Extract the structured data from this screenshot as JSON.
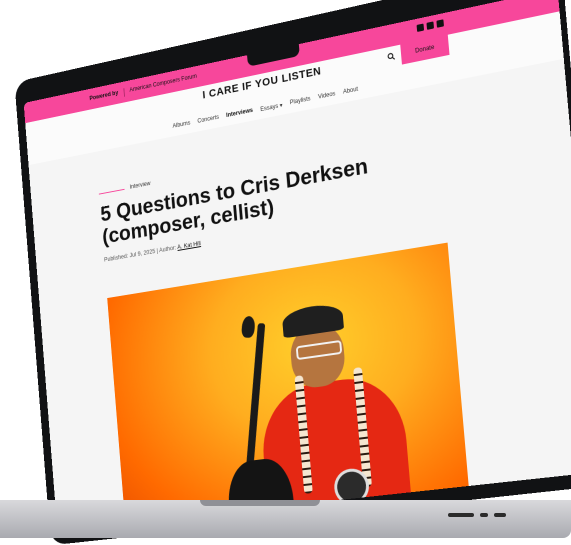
{
  "topbar": {
    "powered_label": "Powered by",
    "forum_label": "American Composers Forum",
    "social_icons": [
      "facebook-icon",
      "instagram-icon",
      "youtube-icon"
    ]
  },
  "header": {
    "site_title": "I CARE IF YOU LISTEN",
    "donate_label": "Donate",
    "nav": [
      {
        "label": "Albums"
      },
      {
        "label": "Concerts"
      },
      {
        "label": "Interviews",
        "active": true
      },
      {
        "label": "Essays ▾"
      },
      {
        "label": "Playlists"
      },
      {
        "label": "Videos"
      },
      {
        "label": "About"
      }
    ]
  },
  "article": {
    "kicker": "Interview",
    "headline": "5 Questions to Cris Derksen (composer, cellist)",
    "meta_prefix": "Published: Jul 9, 2025 | Author: ",
    "author": "A. Kat Hill"
  },
  "colors": {
    "accent": "#f7479b",
    "page_bg": "#f5f5f5",
    "photo_warm": "#ffad1f"
  }
}
